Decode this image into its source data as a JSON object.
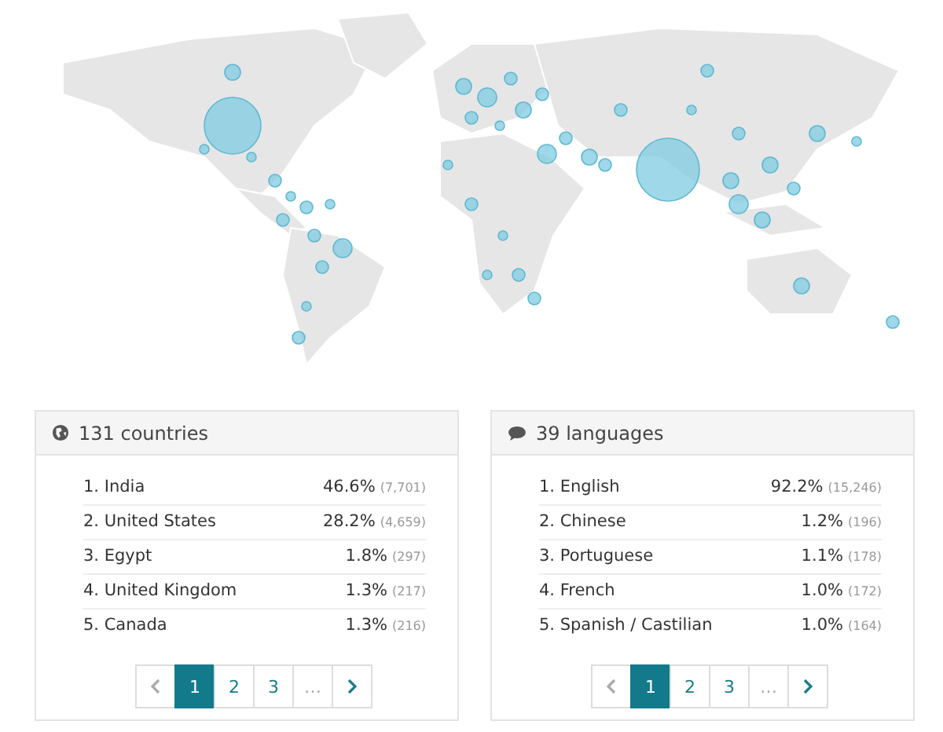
{
  "panels": [
    {
      "kind": "globe",
      "title": "131 countries",
      "rows": [
        {
          "label": "1. India",
          "percent": "46.6%",
          "count": "(7,701)"
        },
        {
          "label": "2. United States",
          "percent": "28.2%",
          "count": "(4,659)"
        },
        {
          "label": "3. Egypt",
          "percent": "1.8%",
          "count": "(297)"
        },
        {
          "label": "4. United Kingdom",
          "percent": "1.3%",
          "count": "(217)"
        },
        {
          "label": "5. Canada",
          "percent": "1.3%",
          "count": "(216)"
        }
      ],
      "pagination": [
        {
          "kind": "prev",
          "disabled": true
        },
        {
          "kind": "page",
          "label": "1",
          "selected": true,
          "disabled": false
        },
        {
          "kind": "page",
          "label": "2",
          "selected": false,
          "disabled": false
        },
        {
          "kind": "page",
          "label": "3",
          "selected": false,
          "disabled": false
        },
        {
          "kind": "page",
          "label": "…",
          "selected": false,
          "disabled": true
        },
        {
          "kind": "next",
          "disabled": false
        }
      ]
    },
    {
      "kind": "chat",
      "title": "39 languages",
      "rows": [
        {
          "label": "1. English",
          "percent": "92.2%",
          "count": "(15,246)"
        },
        {
          "label": "2. Chinese",
          "percent": "1.2%",
          "count": "(196)"
        },
        {
          "label": "3. Portuguese",
          "percent": "1.1%",
          "count": "(178)"
        },
        {
          "label": "4. French",
          "percent": "1.0%",
          "count": "(172)"
        },
        {
          "label": "5. Spanish / Castilian",
          "percent": "1.0%",
          "count": "(164)"
        }
      ],
      "pagination": [
        {
          "kind": "prev",
          "disabled": true
        },
        {
          "kind": "page",
          "label": "1",
          "selected": true,
          "disabled": false
        },
        {
          "kind": "page",
          "label": "2",
          "selected": false,
          "disabled": false
        },
        {
          "kind": "page",
          "label": "3",
          "selected": false,
          "disabled": false
        },
        {
          "kind": "page",
          "label": "…",
          "selected": false,
          "disabled": true
        },
        {
          "kind": "next",
          "disabled": false
        }
      ]
    }
  ]
}
